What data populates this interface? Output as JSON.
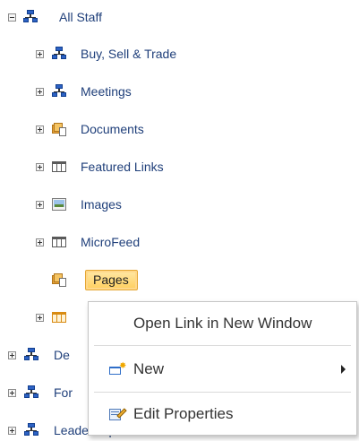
{
  "tree": {
    "root": {
      "label": "All Staff"
    },
    "children": [
      {
        "label": "Buy, Sell & Trade",
        "icon": "site-icon"
      },
      {
        "label": "Meetings",
        "icon": "site-icon"
      },
      {
        "label": "Documents",
        "icon": "library-icon"
      },
      {
        "label": "Featured Links",
        "icon": "list-icon"
      },
      {
        "label": "Images",
        "icon": "image-library-icon"
      },
      {
        "label": "MicroFeed",
        "icon": "list-icon"
      },
      {
        "label": "Pages",
        "icon": "library-icon",
        "selected": true
      },
      {
        "label": "",
        "icon": "list-icon-orange"
      }
    ],
    "siblings": [
      {
        "label": "De",
        "icon": "site-icon"
      },
      {
        "label": "For",
        "icon": "site-icon"
      },
      {
        "label": "Leadership",
        "icon": "site-icon"
      }
    ]
  },
  "context_menu": {
    "items": [
      {
        "label": "Open Link in New Window"
      },
      {
        "label": "New",
        "has_submenu": true,
        "icon": "new-item-icon"
      },
      {
        "label": "Edit Properties",
        "icon": "edit-properties-icon"
      }
    ]
  },
  "colors": {
    "link_text": "#1f3f7a",
    "selection_fill": "#ffcf5d",
    "selection_border": "#e5a735"
  }
}
